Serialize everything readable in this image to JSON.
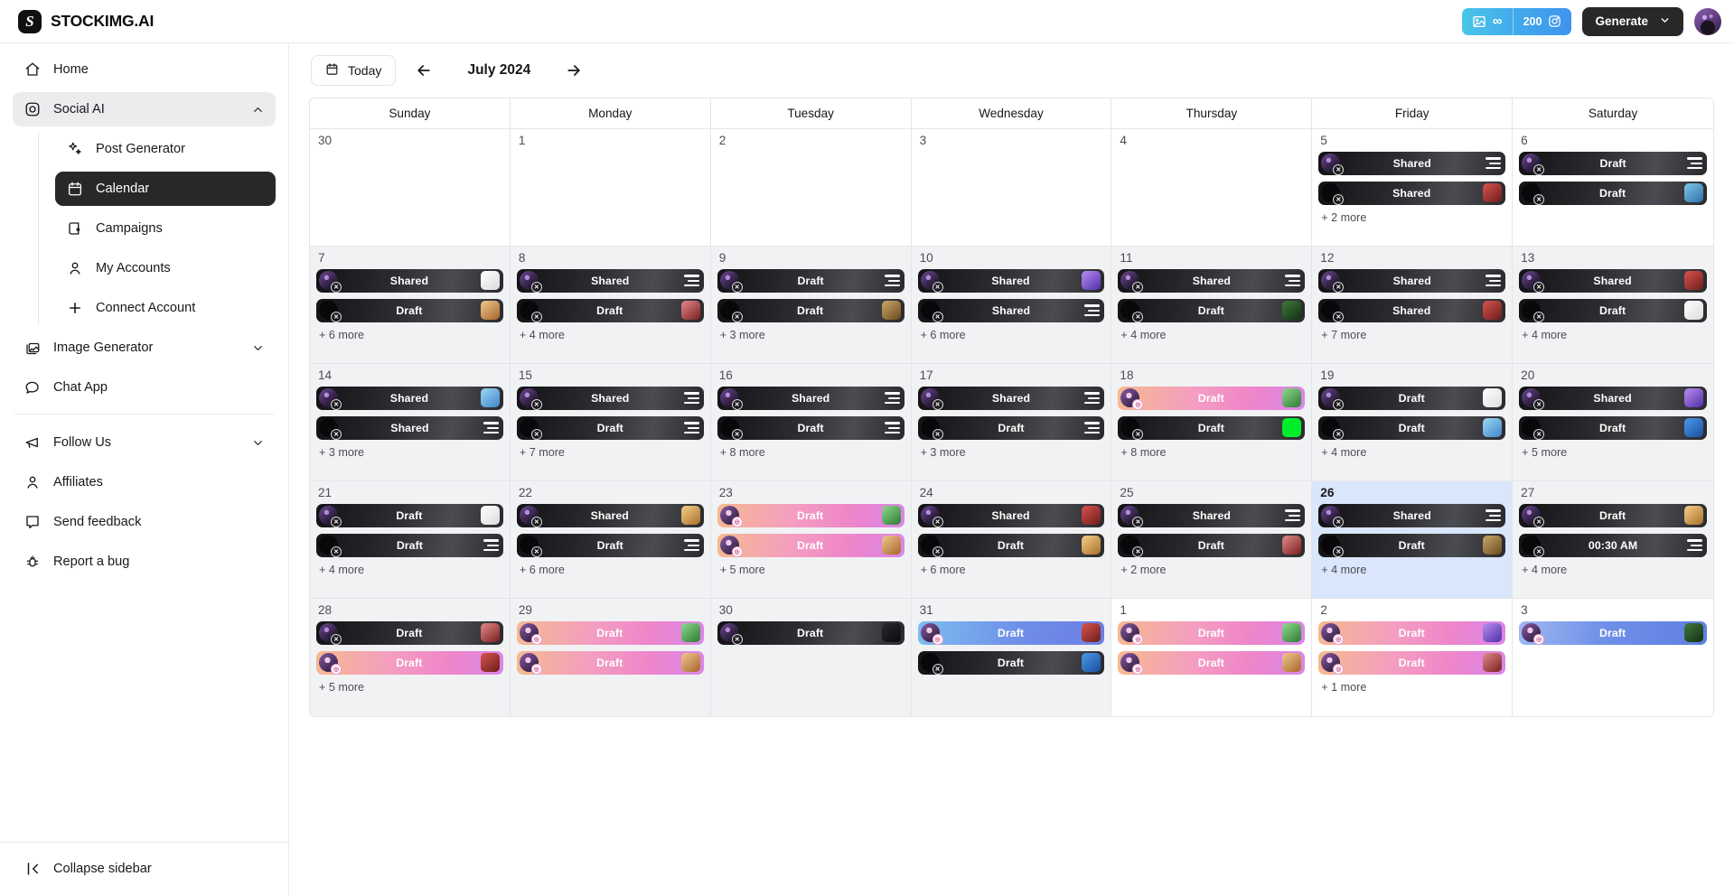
{
  "topbar": {
    "brand_initial": "S",
    "brand_name": "STOCKIMG.AI",
    "credits": {
      "image_value": "∞",
      "social_value": "200"
    },
    "generate_label": "Generate"
  },
  "sidebar": {
    "items": [
      {
        "label": "Home",
        "icon": "home-icon"
      },
      {
        "label": "Social AI",
        "icon": "instagram-icon"
      }
    ],
    "social_children": [
      {
        "label": "Post Generator",
        "icon": "sparkles-icon"
      },
      {
        "label": "Calendar",
        "icon": "calendar-icon"
      },
      {
        "label": "Campaigns",
        "icon": "wallet-icon"
      },
      {
        "label": "My Accounts",
        "icon": "user-icon"
      },
      {
        "label": "Connect Account",
        "icon": "plus-icon"
      }
    ],
    "items2": [
      {
        "label": "Image Generator",
        "icon": "images-icon"
      },
      {
        "label": "Chat App",
        "icon": "chat-icon"
      }
    ],
    "items3": [
      {
        "label": "Follow Us",
        "icon": "megaphone-icon"
      },
      {
        "label": "Affiliates",
        "icon": "user-icon"
      },
      {
        "label": "Send feedback",
        "icon": "message-square-icon"
      },
      {
        "label": "Report a bug",
        "icon": "bug-icon"
      }
    ],
    "collapse_label": "Collapse sidebar"
  },
  "calendar": {
    "today_label": "Today",
    "month_label": "July 2024",
    "weekdays": [
      "Sunday",
      "Monday",
      "Tuesday",
      "Wednesday",
      "Thursday",
      "Friday",
      "Saturday"
    ],
    "weeks": [
      [
        {
          "day": "30",
          "other": true,
          "events": []
        },
        {
          "day": "1",
          "other": true,
          "events": []
        },
        {
          "day": "2",
          "other": true,
          "events": []
        },
        {
          "day": "3",
          "other": true,
          "events": []
        },
        {
          "day": "4",
          "other": true,
          "events": []
        },
        {
          "day": "5",
          "other": true,
          "events": [
            {
              "label": "Shared",
              "style": "dark",
              "badge": "x",
              "right": "lines"
            },
            {
              "label": "Shared",
              "style": "dark",
              "badge": "x",
              "right": "t4"
            }
          ],
          "more": "+ 2 more"
        },
        {
          "day": "6",
          "other": true,
          "events": [
            {
              "label": "Draft",
              "style": "dark",
              "badge": "x",
              "right": "lines"
            },
            {
              "label": "Draft",
              "style": "dark",
              "badge": "x",
              "right": "t3"
            }
          ]
        }
      ],
      [
        {
          "day": "7",
          "events": [
            {
              "label": "Shared",
              "style": "dark",
              "badge": "x",
              "right": "t8"
            },
            {
              "label": "Draft",
              "style": "dark",
              "badge": "x",
              "right": "t6"
            }
          ],
          "more": "+ 6 more"
        },
        {
          "day": "8",
          "events": [
            {
              "label": "Shared",
              "style": "dark",
              "badge": "x",
              "right": "lines"
            },
            {
              "label": "Draft",
              "style": "dark",
              "badge": "x",
              "right": "t13"
            }
          ],
          "more": "+ 4 more"
        },
        {
          "day": "9",
          "events": [
            {
              "label": "Draft",
              "style": "dark",
              "badge": "x",
              "right": "lines"
            },
            {
              "label": "Draft",
              "style": "dark",
              "badge": "x",
              "right": "t16"
            }
          ],
          "more": "+ 3 more"
        },
        {
          "day": "10",
          "events": [
            {
              "label": "Shared",
              "style": "dark",
              "badge": "x",
              "right": "t9"
            },
            {
              "label": "Shared",
              "style": "dark",
              "badge": "x",
              "right": "lines"
            }
          ],
          "more": "+ 6 more"
        },
        {
          "day": "11",
          "events": [
            {
              "label": "Shared",
              "style": "dark",
              "badge": "x",
              "right": "lines"
            },
            {
              "label": "Draft",
              "style": "dark",
              "badge": "x",
              "right": "t15"
            }
          ],
          "more": "+ 4 more"
        },
        {
          "day": "12",
          "events": [
            {
              "label": "Shared",
              "style": "dark",
              "badge": "x",
              "right": "lines"
            },
            {
              "label": "Shared",
              "style": "dark",
              "badge": "x",
              "right": "t4"
            }
          ],
          "more": "+ 7 more"
        },
        {
          "day": "13",
          "events": [
            {
              "label": "Shared",
              "style": "dark",
              "badge": "x",
              "right": "t4"
            },
            {
              "label": "Draft",
              "style": "dark",
              "badge": "x",
              "right": "t8"
            }
          ],
          "more": "+ 4 more"
        }
      ],
      [
        {
          "day": "14",
          "events": [
            {
              "label": "Shared",
              "style": "dark",
              "badge": "x",
              "right": "t11"
            },
            {
              "label": "Shared",
              "style": "dark",
              "badge": "x",
              "right": "lines"
            }
          ],
          "more": "+ 3 more"
        },
        {
          "day": "15",
          "events": [
            {
              "label": "Shared",
              "style": "dark",
              "badge": "x",
              "right": "lines"
            },
            {
              "label": "Draft",
              "style": "dark",
              "badge": "x",
              "right": "lines"
            }
          ],
          "more": "+ 7 more"
        },
        {
          "day": "16",
          "events": [
            {
              "label": "Shared",
              "style": "dark",
              "badge": "x",
              "right": "lines"
            },
            {
              "label": "Draft",
              "style": "dark",
              "badge": "x",
              "right": "lines"
            }
          ],
          "more": "+ 8 more"
        },
        {
          "day": "17",
          "events": [
            {
              "label": "Shared",
              "style": "dark",
              "badge": "x",
              "right": "lines"
            },
            {
              "label": "Draft",
              "style": "dark",
              "badge": "x",
              "right": "lines"
            }
          ],
          "more": "+ 3 more"
        },
        {
          "day": "18",
          "events": [
            {
              "label": "Draft",
              "style": "pink",
              "badge": "ig",
              "right": "t5"
            },
            {
              "label": "Draft",
              "style": "dark",
              "badge": "x",
              "right": "t10"
            }
          ],
          "more": "+ 8 more"
        },
        {
          "day": "19",
          "events": [
            {
              "label": "Draft",
              "style": "dark",
              "badge": "x",
              "right": "t8"
            },
            {
              "label": "Draft",
              "style": "dark",
              "badge": "x",
              "right": "t11"
            }
          ],
          "more": "+ 4 more"
        },
        {
          "day": "20",
          "events": [
            {
              "label": "Shared",
              "style": "dark",
              "badge": "x",
              "right": "t9"
            },
            {
              "label": "Draft",
              "style": "dark",
              "badge": "x",
              "right": "t14"
            }
          ],
          "more": "+ 5 more"
        }
      ],
      [
        {
          "day": "21",
          "events": [
            {
              "label": "Draft",
              "style": "dark",
              "badge": "x",
              "right": "t8"
            },
            {
              "label": "Draft",
              "style": "dark",
              "badge": "x",
              "right": "lines"
            }
          ],
          "more": "+ 4 more"
        },
        {
          "day": "22",
          "events": [
            {
              "label": "Shared",
              "style": "dark",
              "badge": "x",
              "right": "t12"
            },
            {
              "label": "Draft",
              "style": "dark",
              "badge": "x",
              "right": "lines"
            }
          ],
          "more": "+ 6 more"
        },
        {
          "day": "23",
          "events": [
            {
              "label": "Draft",
              "style": "pink",
              "badge": "ig",
              "right": "t5"
            },
            {
              "label": "Draft",
              "style": "pink",
              "badge": "ig",
              "right": "t6"
            }
          ],
          "more": "+ 5 more"
        },
        {
          "day": "24",
          "events": [
            {
              "label": "Shared",
              "style": "dark",
              "badge": "x",
              "right": "t4"
            },
            {
              "label": "Draft",
              "style": "dark",
              "badge": "x",
              "right": "t12"
            }
          ],
          "more": "+ 6 more"
        },
        {
          "day": "25",
          "events": [
            {
              "label": "Shared",
              "style": "dark",
              "badge": "x",
              "right": "lines"
            },
            {
              "label": "Draft",
              "style": "dark",
              "badge": "x",
              "right": "t13"
            }
          ],
          "more": "+ 2 more"
        },
        {
          "day": "26",
          "today": true,
          "events": [
            {
              "label": "Shared",
              "style": "dark",
              "badge": "x",
              "right": "lines"
            },
            {
              "label": "Draft",
              "style": "dark",
              "badge": "x",
              "right": "t16"
            }
          ],
          "more": "+ 4 more"
        },
        {
          "day": "27",
          "events": [
            {
              "label": "Draft",
              "style": "dark",
              "badge": "x",
              "right": "t12"
            },
            {
              "label": "00:30 AM",
              "style": "dark",
              "badge": "x",
              "right": "lines"
            }
          ],
          "more": "+ 4 more"
        }
      ],
      [
        {
          "day": "28",
          "events": [
            {
              "label": "Draft",
              "style": "dark",
              "badge": "x",
              "right": "t13"
            },
            {
              "label": "Draft",
              "style": "pink",
              "badge": "ig",
              "right": "t4"
            }
          ],
          "more": "+ 5 more"
        },
        {
          "day": "29",
          "events": [
            {
              "label": "Draft",
              "style": "pink",
              "badge": "ig",
              "right": "t5"
            },
            {
              "label": "Draft",
              "style": "pink",
              "badge": "ig",
              "right": "t6"
            }
          ]
        },
        {
          "day": "30",
          "events": [
            {
              "label": "Draft",
              "style": "dark",
              "badge": "x",
              "right": "t7"
            }
          ]
        },
        {
          "day": "31",
          "events": [
            {
              "label": "Draft",
              "style": "bluebright",
              "badge": "ig",
              "right": "t4"
            },
            {
              "label": "Draft",
              "style": "dark",
              "badge": "x",
              "right": "t14"
            }
          ]
        },
        {
          "day": "1",
          "other": true,
          "events": [
            {
              "label": "Draft",
              "style": "pink",
              "badge": "ig",
              "right": "t5"
            },
            {
              "label": "Draft",
              "style": "pink",
              "badge": "ig",
              "right": "t6"
            }
          ]
        },
        {
          "day": "2",
          "other": true,
          "events": [
            {
              "label": "Draft",
              "style": "pink",
              "badge": "ig",
              "right": "t9"
            },
            {
              "label": "Draft",
              "style": "pink",
              "badge": "ig",
              "right": "t13"
            }
          ],
          "more": "+ 1 more"
        },
        {
          "day": "3",
          "other": true,
          "events": [
            {
              "label": "Draft",
              "style": "blue",
              "badge": "ig",
              "right": "t15"
            }
          ]
        }
      ]
    ]
  }
}
